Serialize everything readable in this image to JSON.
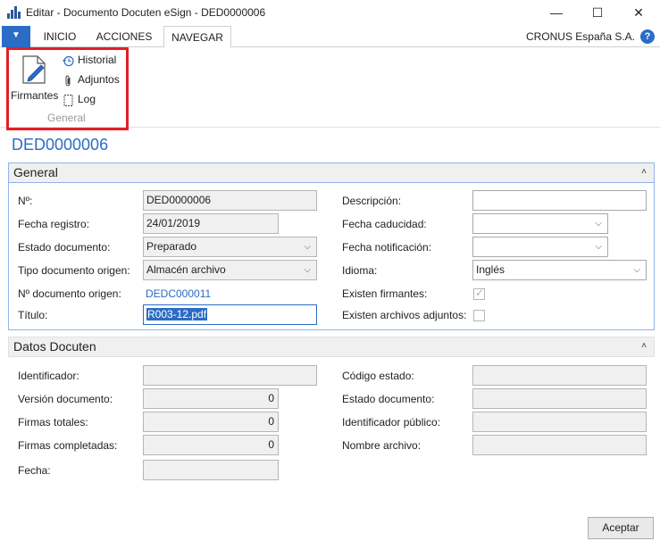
{
  "window": {
    "title": "Editar - Documento Docuten eSign - DED0000006",
    "minimize": "—",
    "maximize": "☐",
    "close": "✕"
  },
  "ribbon": {
    "menu_glyph": "▼",
    "tabs": [
      {
        "label": "INICIO"
      },
      {
        "label": "ACCIONES"
      },
      {
        "label": "NAVEGAR"
      }
    ],
    "company": "CRONUS España S.A.",
    "help": "?",
    "firmantes": "Firmantes",
    "historial": "Historial",
    "adjuntos": "Adjuntos",
    "log": "Log",
    "group_label": "General",
    "icons": {
      "firmantes": "document-edit-icon",
      "historial": "history-icon",
      "adjuntos": "paperclip-icon",
      "log": "log-icon"
    },
    "highlight_color": "#e21f26"
  },
  "page_title": "DED0000006",
  "general": {
    "header": "General",
    "collapse_glyph": "˄",
    "no_label": "Nº:",
    "no_value": "DED0000006",
    "fecha_registro_label": "Fecha registro:",
    "fecha_registro_value": "24/01/2019",
    "estado_label": "Estado documento:",
    "estado_value": "Preparado",
    "tipo_label": "Tipo documento origen:",
    "tipo_value": "Almacén archivo",
    "no_origen_label": "Nº documento origen:",
    "no_origen_value": "DEDC000011",
    "titulo_label": "Título:",
    "titulo_value": "R003-12.pdf",
    "descripcion_label": "Descripción:",
    "descripcion_value": "",
    "fecha_caducidad_label": "Fecha caducidad:",
    "fecha_caducidad_value": "",
    "fecha_notificacion_label": "Fecha notificación:",
    "fecha_notificacion_value": "",
    "idioma_label": "Idioma:",
    "idioma_value": "Inglés",
    "existen_firmantes_label": "Existen firmantes:",
    "existen_firmantes_checked": true,
    "existen_adjuntos_label": "Existen archivos adjuntos:",
    "existen_adjuntos_checked": false,
    "dropdown_glyph": "⌵",
    "check_glyph": "✓"
  },
  "datos": {
    "header": "Datos Docuten",
    "collapse_glyph": "˄",
    "identificador_label": "Identificador:",
    "identificador_value": "",
    "version_label": "Versión documento:",
    "version_value": "0",
    "firmas_totales_label": "Firmas totales:",
    "firmas_totales_value": "0",
    "firmas_completadas_label": "Firmas completadas:",
    "firmas_completadas_value": "0",
    "fecha_label": "Fecha:",
    "fecha_value": "",
    "codigo_estado_label": "Código estado:",
    "codigo_estado_value": "",
    "estado_documento_label": "Estado documento:",
    "estado_documento_value": "",
    "identificador_publico_label": "Identificador público:",
    "identificador_publico_value": "",
    "nombre_archivo_label": "Nombre archivo:",
    "nombre_archivo_value": ""
  },
  "footer": {
    "accept": "Aceptar"
  }
}
